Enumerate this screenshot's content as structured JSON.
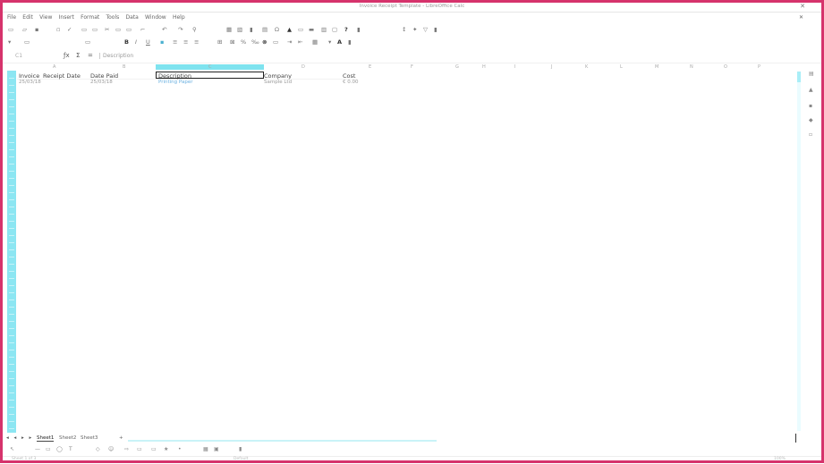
{
  "window": {
    "title": "Invoice Receipt Template - LibreOffice Calc",
    "close_glyph": "✕"
  },
  "menu": {
    "items": [
      "File",
      "Edit",
      "View",
      "Insert",
      "Format",
      "Tools",
      "Data",
      "Window",
      "Help"
    ],
    "close_glyph": "✕"
  },
  "formula_bar": {
    "name_box": "C1",
    "fx": "ƒx",
    "sum": "Σ",
    "equals": "=",
    "content": "Description"
  },
  "columns": [
    "A",
    "B",
    "C",
    "D",
    "E",
    "F",
    "G",
    "H",
    "I",
    "J",
    "K",
    "L",
    "M",
    "N",
    "O",
    "P"
  ],
  "table": {
    "headers": [
      "Invoice",
      "Receipt Date",
      "Date Paid",
      "Description",
      "Company",
      "Cost"
    ],
    "row1": [
      "25/03/18",
      "",
      "25/03/18",
      "Printing Paper",
      "Sample Ltd",
      "€ 0.00"
    ]
  },
  "sheets": [
    "Sheet1",
    "Sheet2",
    "Sheet3"
  ],
  "sheet_nav": "◂ ◂ ▸ ▸",
  "sheet_add": "+",
  "status": {
    "sheet": "Sheet 1 of 3",
    "style": "Default",
    "zoom": "100%"
  }
}
